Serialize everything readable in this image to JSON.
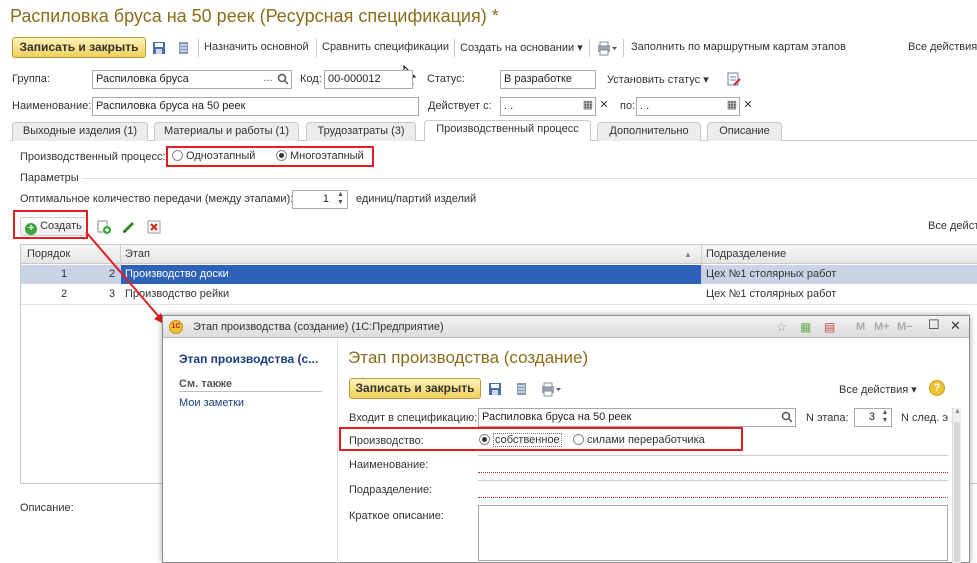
{
  "window": {
    "title": "Распиловка бруса на 50 реек (Ресурсная спецификация) *"
  },
  "toolbar": {
    "save_close": "Записать и закрыть",
    "set_main": "Назначить основной",
    "compare": "Сравнить спецификации",
    "create_based": "Создать на основании",
    "fill_routes": "Заполнить по маршрутным картам этапов",
    "all_actions": "Все действия"
  },
  "form": {
    "group_label": "Группа:",
    "group_value": "Распиловка бруса",
    "code_label": "Код:",
    "code_value": "00-000012",
    "status_label": "Статус:",
    "status_value": "В разработке",
    "set_status": "Установить статус",
    "name_label": "Наименование:",
    "name_value": "Распиловка бруса на 50 реек",
    "valid_from_label": "Действует с:",
    "valid_from_value": ".  .",
    "to_label": "по:",
    "to_value": ".  ."
  },
  "tabs": [
    {
      "label": "Выходные изделия (1)"
    },
    {
      "label": "Материалы и работы (1)"
    },
    {
      "label": "Трудозатраты (3)"
    },
    {
      "label": "Производственный процесс"
    },
    {
      "label": "Дополнительно"
    },
    {
      "label": "Описание"
    }
  ],
  "process": {
    "label": "Производственный процесс:",
    "opt1": "Одноэтапный",
    "opt2": "Многоэтапный",
    "selected": "Многоэтапный"
  },
  "params": {
    "header": "Параметры",
    "transfer_label": "Оптимальное количество передачи (между этапами):",
    "transfer_value": "1",
    "transfer_unit": "единиц/партий изделий"
  },
  "stages_toolbar": {
    "create": "Создать",
    "all_actions": "Все дейст"
  },
  "table": {
    "columns": [
      "Порядок",
      "Этап",
      "Подразделение"
    ],
    "rows": [
      {
        "order": "1",
        "num": "2",
        "stage": "Производство доски",
        "dept": "Цех №1 столярных работ"
      },
      {
        "order": "2",
        "num": "3",
        "stage": "Производство рейки",
        "dept": "Цех №1 столярных работ"
      }
    ]
  },
  "description_label": "Описание:",
  "dialog": {
    "titlebar": "Этап производства (создание)  (1С:Предприятие)",
    "tb_m": "M",
    "tb_mplus": "M+",
    "tb_mminus": "M−",
    "nav_title": "Этап производства (с...",
    "see_also": "См. также",
    "notes": "Мои заметки",
    "heading": "Этап производства (создание)",
    "save_close": "Записать и закрыть",
    "all_actions": "Все действия",
    "spec_label": "Входит в спецификацию:",
    "spec_value": "Распиловка бруса на 50 реек",
    "stage_no_label": "N этапа:",
    "stage_no_value": "3",
    "next_label": "N след. э",
    "prod_label": "Производство:",
    "prod_opt1": "собственное",
    "prod_opt2": "силами переработчика",
    "name_label": "Наименование:",
    "dept_label": "Подразделение:",
    "short_desc_label": "Краткое описание:"
  }
}
